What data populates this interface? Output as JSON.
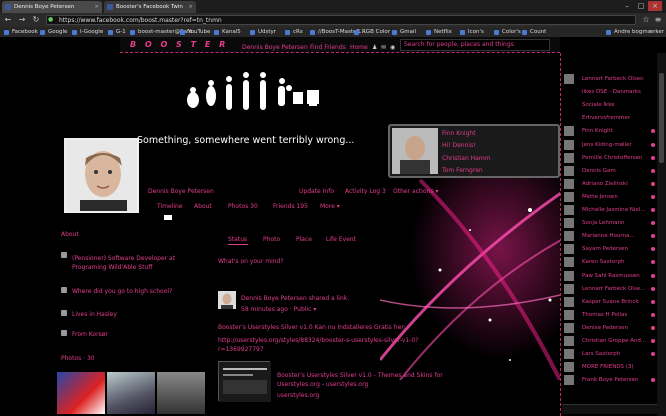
{
  "browser": {
    "tabs": [
      {
        "label": "Dennis Boye Petersen"
      },
      {
        "label": "Booster's Facebook Twin"
      }
    ],
    "url": "https://www.facebook.com/boost.master?ref=tn_tnmn",
    "bookmarks": [
      "Facebook",
      "Google",
      "I-Google",
      "G-1",
      "boost-master@Safe...",
      "YouTube",
      "Kanal5",
      "Udstyr",
      "cRs",
      "//BoosT-MasteR...",
      "RGB Color",
      "Gmail",
      "Netflix",
      "Icon's",
      "Color's",
      "Count",
      "Andre bogmærker"
    ]
  },
  "fb_header": {
    "logo": "B O O S T E R",
    "user_link": "Dennis Boye Petersen",
    "find_friends": "Find Friends",
    "home": "Home",
    "search_placeholder": "Search for people, places and things"
  },
  "cover": {
    "error_message": "Something, somewhere went terribly wrong..."
  },
  "popup": {
    "lines": [
      "Finn Knight",
      "Hi! Dennis!",
      "Christian Hamm",
      "Tom Ferngren"
    ]
  },
  "profile": {
    "name": "Dennis Boye Petersen",
    "update_info": "Update Info",
    "activity_log": "Activity Log",
    "activity_count": "3",
    "other_actions": "Other actions",
    "tabs": [
      "Timeline",
      "About",
      "Photos 30",
      "Friends 195",
      "More"
    ]
  },
  "about": {
    "heading": "About",
    "work": "(Pensioner) Software Developer at Programing Wild'Able Stuff",
    "school": "Where did you go to high school?",
    "lives": "Lives in Hasley",
    "from": "From Korsør",
    "photos_label": "Photos",
    "photos_count": "30"
  },
  "composer": {
    "tabs": [
      "Status",
      "Photo",
      "Place",
      "Life Event"
    ],
    "prompt": "What's on your mind?"
  },
  "post": {
    "author_line": "Dennis Boye Petersen shared a link.",
    "time": "58 minutes ago",
    "privacy": "Public",
    "text1": "Booster's Userstyles Silver v1.0 Kan nu Indstalleres Gratis her:",
    "text2": "http://userstyles.org/styles/88324/booster-s-userstyles-silver-v1-0?r=1369927797",
    "link_title": "Booster's Userstyles Silver v1.0 - Themes and Skins for Userstyles.org - userstyles.org",
    "link_domain": "userstyles.org"
  },
  "chat": {
    "friends": [
      "Lennart Farbeck Olsen",
      "likes DSE - Danmarks",
      "Sociale Ikke",
      "Erhvervsfremmer",
      "Finn Knight",
      "Jens Kiding-møller",
      "Pernille Christoffersen",
      "Dennis Gam",
      "Adriano Zielinski",
      "Mette Jensen",
      "Michelle Jasmina Niel...",
      "Sonja Lehmann",
      "Marianne Hourna...",
      "Sayam Pedersen",
      "Karen Saxtorph",
      "Paw Sahl Rasmussen",
      "Lennart Farbeck Olse...",
      "Kasper Svane Brinck",
      "Thomas H Pollas",
      "Denise Pedersen",
      "Christian Groppe And...",
      "Lars Saxtorph",
      "MORE FRIENDS (3)",
      "Frank Boye Petersen"
    ]
  },
  "colors": {
    "accent": "#e33d8e",
    "bg": "#000000"
  }
}
